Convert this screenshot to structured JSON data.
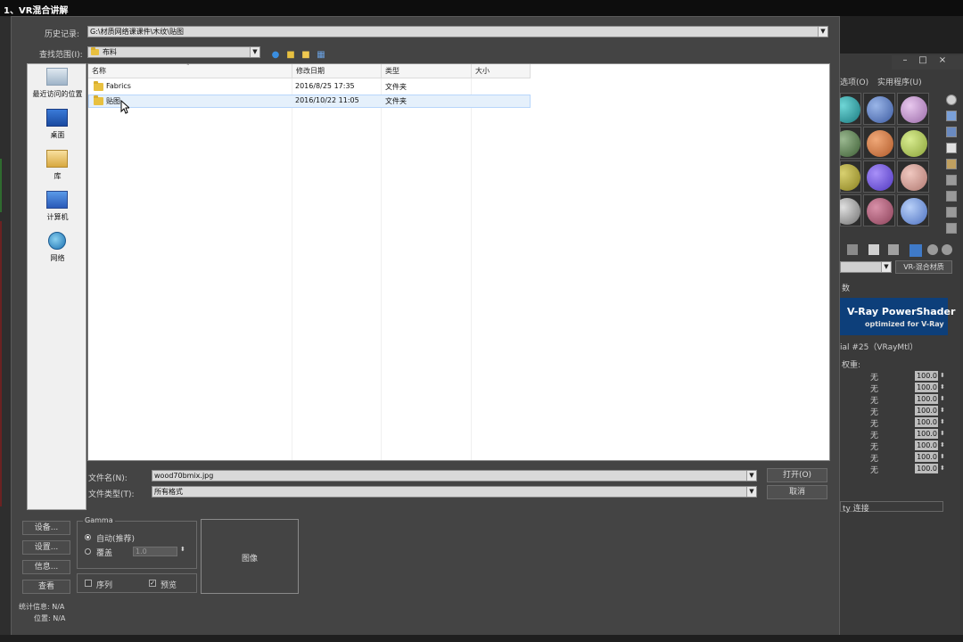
{
  "window": {
    "title": "1、VR混合讲解"
  },
  "dialog": {
    "history_label": "历史记录:",
    "history_value": "G:\\材质网络课课件\\木纹\\贴图",
    "lookin_label": "查找范围(I):",
    "lookin_value": "布料",
    "places": [
      {
        "label": "最近访问的位置",
        "icon": "recent-places-icon"
      },
      {
        "label": "桌面",
        "icon": "desktop-icon"
      },
      {
        "label": "库",
        "icon": "libraries-icon"
      },
      {
        "label": "计算机",
        "icon": "computer-icon"
      },
      {
        "label": "网络",
        "icon": "network-icon"
      }
    ],
    "columns": {
      "name": "名称",
      "date": "修改日期",
      "type": "类型",
      "size": "大小"
    },
    "files": [
      {
        "name": "Fabrics",
        "date": "2016/8/25 17:35",
        "type": "文件夹"
      },
      {
        "name": "贴图",
        "date": "2016/10/22 11:05",
        "type": "文件夹"
      }
    ],
    "filename_label": "文件名(N):",
    "filename_value": "wood70bmix.jpg",
    "filetype_label": "文件类型(T):",
    "filetype_value": "所有格式",
    "open_button": "打开(O)",
    "cancel_button": "取消",
    "side_buttons": [
      "设备...",
      "设置...",
      "信息...",
      "查看"
    ],
    "gamma": {
      "title": "Gamma",
      "auto_label": "自动(推荐)",
      "override_label": "覆盖",
      "override_value": "1.0"
    },
    "sequence_label": "序列",
    "preview_label": "预览",
    "image_label": "图像",
    "stats_label": "统计信息: N/A",
    "location_label": "位置: N/A"
  },
  "background_panel": {
    "menu_items": [
      "选项(O)",
      "实用程序(U)"
    ],
    "material_type_button": "VR-混合材质",
    "section_label": "数",
    "banner_line1": "V-Ray PowerShader",
    "banner_line2": "optimized for V-Ray",
    "material_name": "ial #25（VRayMtl）",
    "params_label": "权重:",
    "param_rows": [
      {
        "map": "无",
        "value": "100.0"
      },
      {
        "map": "无",
        "value": "100.0"
      },
      {
        "map": "无",
        "value": "100.0"
      },
      {
        "map": "无",
        "value": "100.0"
      },
      {
        "map": "无",
        "value": "100.0"
      },
      {
        "map": "无",
        "value": "100.0"
      },
      {
        "map": "无",
        "value": "100.0"
      },
      {
        "map": "无",
        "value": "100.0"
      },
      {
        "map": "无",
        "value": "100.0"
      }
    ],
    "bottom_label": "ty 连接"
  }
}
